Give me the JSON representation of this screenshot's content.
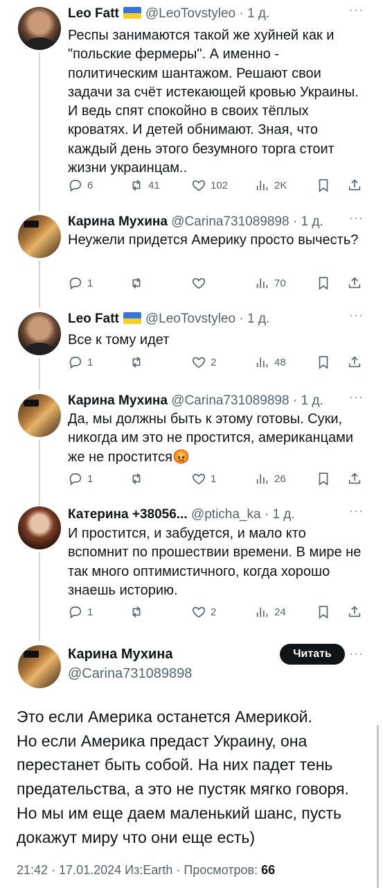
{
  "replies": [
    {
      "name": "Leo Fatt",
      "flag": true,
      "handle": "@LeoTovstyleo",
      "time": "1 д.",
      "text": "Респы занимаются такой же хуйней как и \"польские фермеры\". А именно - политическим шантажом. Решают свои задачи за счёт истекающей кровью Украины. И ведь спят спокойно в своих тёплых кроватях. И детей обнимают. Зная, что каждый день этого безумного торга стоит жизни украинцам..",
      "replies": "6",
      "retweets": "41",
      "likes": "102",
      "views": "2K"
    },
    {
      "name": "Карина Мухина",
      "flag": false,
      "handle": "@Carina731089898",
      "time": "1 д.",
      "text": "Неужели придется Америку просто вычесть?",
      "replies": "1",
      "retweets": "",
      "likes": "",
      "views": "70"
    },
    {
      "name": "Leo Fatt",
      "flag": true,
      "handle": "@LeoTovstyleo",
      "time": "1 д.",
      "text": "Все к тому идет",
      "replies": "1",
      "retweets": "",
      "likes": "2",
      "views": "48"
    },
    {
      "name": "Карина Мухина",
      "flag": false,
      "handle": "@Carina731089898",
      "time": "1 д.",
      "text": "Да, мы должны быть к этому готовы. Суки, никогда им это не простится, американцами же не простится😡",
      "replies": "1",
      "retweets": "",
      "likes": "1",
      "views": "26"
    },
    {
      "name": "Катерина +38056...",
      "flag": false,
      "handle": "@pticha_ka",
      "time": "1 д.",
      "text": "И простится, и забудется, и мало кто вспомнит по прошествии времени. В мире не так много оптимистичного, когда хорошо знаешь историю.",
      "replies": "1",
      "retweets": "",
      "likes": "2",
      "views": "24"
    }
  ],
  "main": {
    "name": "Карина Мухина",
    "handle": "@Carina731089898",
    "follow_label": "Читать",
    "text_lines": [
      "Это если Америка останется Америкой.",
      "Но если Америка предаст Украину, она",
      "перестанет быть собой. На них падет тень",
      "предательства, а это не пустяк мягко говоря.",
      "Но мы им еще даем маленький шанс, пусть",
      "докажут миру что они еще есть)"
    ],
    "meta_prefix": "21:42 · 17.01.2024 Из:Earth · Просмотров: ",
    "views": "66"
  },
  "icons": {
    "reply": "reply-icon",
    "retweet": "retweet-icon",
    "like": "heart-icon",
    "views": "views-icon",
    "bookmark": "bookmark-icon",
    "share": "share-icon",
    "more": "more-icon"
  }
}
